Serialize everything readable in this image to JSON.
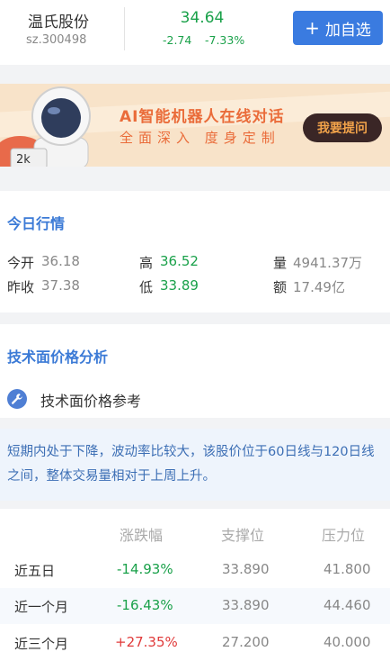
{
  "header": {
    "stock_name": "温氏股份",
    "stock_code": "sz.300498",
    "price": "34.64",
    "change": "-2.74",
    "change_pct": "-7.33%",
    "add_button": "加自选",
    "add_icon": "plus-icon"
  },
  "banner": {
    "title": "AI智能机器人在线对话",
    "subtitle": "全面深入  度身定制",
    "ask_button": "我要提问",
    "image": "astronaut-illustration"
  },
  "today": {
    "title": "今日行情",
    "open_label": "今开",
    "open_value": "36.18",
    "high_label": "高",
    "high_value": "36.52",
    "volume_label": "量",
    "volume_value": "4941.37万",
    "prev_close_label": "昨收",
    "prev_close_value": "37.38",
    "low_label": "低",
    "low_value": "33.89",
    "amount_label": "额",
    "amount_value": "17.49亿"
  },
  "analysis": {
    "title": "技术面价格分析",
    "reference_label": "技术面价格参考",
    "reference_icon": "wrench-icon",
    "summary": "短期内处于下降，波动率比较大，该股价位于60日线与120日线之间，整体交易量相对于上周上升。",
    "table": {
      "headers": [
        "涨跌幅",
        "支撑位",
        "压力位"
      ],
      "rows": [
        {
          "period": "近五日",
          "change": "-14.93%",
          "support": "33.890",
          "resistance": "41.800"
        },
        {
          "period": "近一个月",
          "change": "-16.43%",
          "support": "33.890",
          "resistance": "44.460"
        },
        {
          "period": "近三个月",
          "change": "+27.35%",
          "support": "27.200",
          "resistance": "40.000"
        }
      ]
    }
  },
  "colors": {
    "up": "#e03a3a",
    "down": "#1aa14a",
    "accent": "#3b7ad6"
  }
}
